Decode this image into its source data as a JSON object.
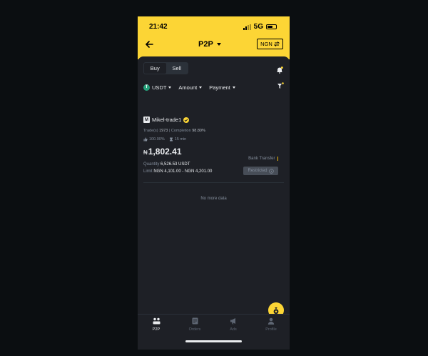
{
  "status_bar": {
    "time": "21:42",
    "network": "5G"
  },
  "nav": {
    "title": "P2P",
    "currency": "NGN"
  },
  "toggle": {
    "buy": "Buy",
    "sell": "Sell"
  },
  "filters": {
    "asset": "USDT",
    "amount": "Amount",
    "payment": "Payment"
  },
  "ad": {
    "avatar_letter": "M",
    "merchant": "Mikel-trade1",
    "trades_label": "Trade(s)",
    "trades": "1973",
    "completion_label": "Completion",
    "completion": "98.80%",
    "rating": "100.00%",
    "time": "15 min",
    "price_symbol": "₦",
    "price": "1,802.41",
    "quantity_label": "Quantity",
    "quantity": "6,526.53 USDT",
    "limit_label": "Limit",
    "limit": "NGN 4,101.00 - NGN 4,201.00",
    "payment_method": "Bank Transfer",
    "action": "Restricted"
  },
  "no_more": "No more data",
  "tabs": [
    "P2P",
    "Orders",
    "Ads",
    "Profile"
  ],
  "colors": {
    "accent": "#fcd535",
    "background": "#1e2026",
    "usdt": "#26a17b"
  }
}
